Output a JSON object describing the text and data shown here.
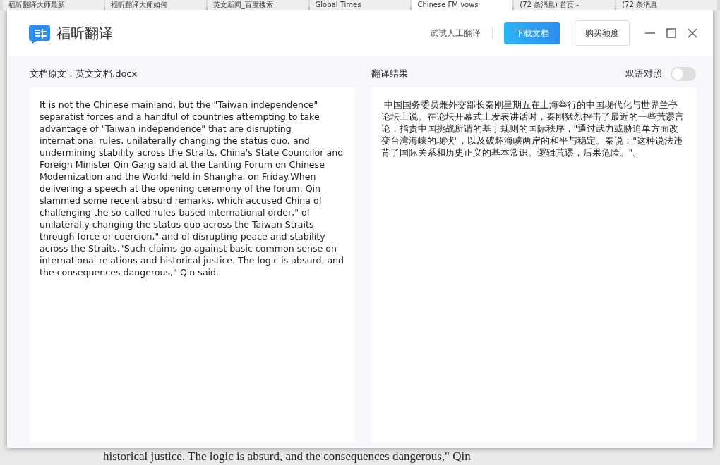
{
  "browser_tabs": [
    {
      "title": "福昕翻译大师最新",
      "selected": false
    },
    {
      "title": "福昕翻译大师如何",
      "selected": false
    },
    {
      "title": "英文新闻_百度搜索",
      "selected": false
    },
    {
      "title": "Global Times",
      "selected": false
    },
    {
      "title": "Chinese FM vows",
      "selected": true
    },
    {
      "title": "(72 条消息) 首页 -",
      "selected": false
    },
    {
      "title": "(72 条消息",
      "selected": false
    }
  ],
  "window": {
    "title": "福昕翻译"
  },
  "header": {
    "human_translation": "试试人工翻译",
    "download_button": "下载文档",
    "buy_button": "购买额度"
  },
  "source_panel": {
    "label": "文档原文：英文文档.docx",
    "text": "It is not the Chinese mainland, but the \"Taiwan independence\" separatist forces and a handful of countries attempting to take advantage of \"Taiwan independence\" that are disrupting international rules, unilaterally changing the status quo, and undermining stability across the Straits, China's State Councilor and Foreign Minister Qin Gang said at the Lanting Forum on Chinese Modernization and the World held in Shanghai on Friday.When delivering a speech at the opening ceremony of the forum, Qin slammed some recent absurd remarks, which accused China of challenging the so-called rules-based international order,\" of unilaterally changing the status quo across the Taiwan Straits through force or coercion,\" and of disrupting peace and stability across the Straits.\"Such claims go against basic common sense on international relations and historical justice. The logic is absurd, and the consequences dangerous,\" Qin said."
  },
  "result_panel": {
    "label": "翻译结果",
    "bilingual_toggle": {
      "label": "双语对照",
      "on": false
    },
    "text": " 中国国务委员兼外交部长秦刚星期五在上海举行的中国现代化与世界兰亭论坛上说。在论坛开幕式上发表讲话时，秦刚猛烈抨击了最近的一些荒谬言论，指责中国挑战所谓的基于规则的国际秩序，\"通过武力或胁迫单方面改变台湾海峡的现状\"，以及破坏海峡两岸的和平与稳定。秦说：\"这种说法违背了国际关系和历史正义的基本常识。逻辑荒谬，后果危险。\"。"
  },
  "background_page_text": "historical justice. The logic is absurd, and the consequences dangerous,\" Qin"
}
